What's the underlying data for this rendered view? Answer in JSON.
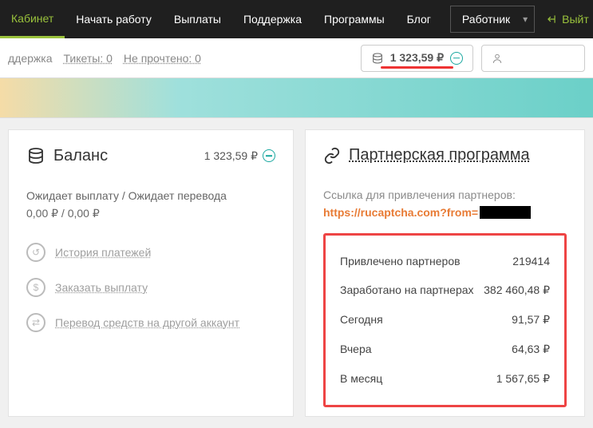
{
  "nav": {
    "items": [
      "Кабинет",
      "Начать работу",
      "Выплаты",
      "Поддержка",
      "Программы",
      "Блог"
    ],
    "role": "Работник",
    "logout": "Выйт"
  },
  "subbar": {
    "support": "ддержка",
    "tickets": "Тикеты: 0",
    "unread": "Не прочтено: 0",
    "balance": "1 323,59 ₽"
  },
  "balance_card": {
    "title": "Баланс",
    "value": "1 323,59 ₽",
    "pending_label": "Ожидает выплату / Ожидает перевода",
    "pending_value": "0,00 ₽ / 0,00 ₽",
    "actions": {
      "history": "История платежей",
      "request": "Заказать выплату",
      "transfer": "Перевод средств на другой аккаунт"
    }
  },
  "partner_card": {
    "title": "Партнерская программа",
    "ref_label": "Ссылка для привлечения партнеров:",
    "ref_link": "https://rucaptcha.com?from=",
    "stats": {
      "referrals_label": "Привлечено партнеров",
      "referrals_value": "219414",
      "earned_label": "Заработано на партнерах",
      "earned_value": "382 460,48 ₽",
      "today_label": "Сегодня",
      "today_value": "91,57 ₽",
      "yesterday_label": "Вчера",
      "yesterday_value": "64,63 ₽",
      "month_label": "В месяц",
      "month_value": "1 567,65 ₽"
    }
  }
}
